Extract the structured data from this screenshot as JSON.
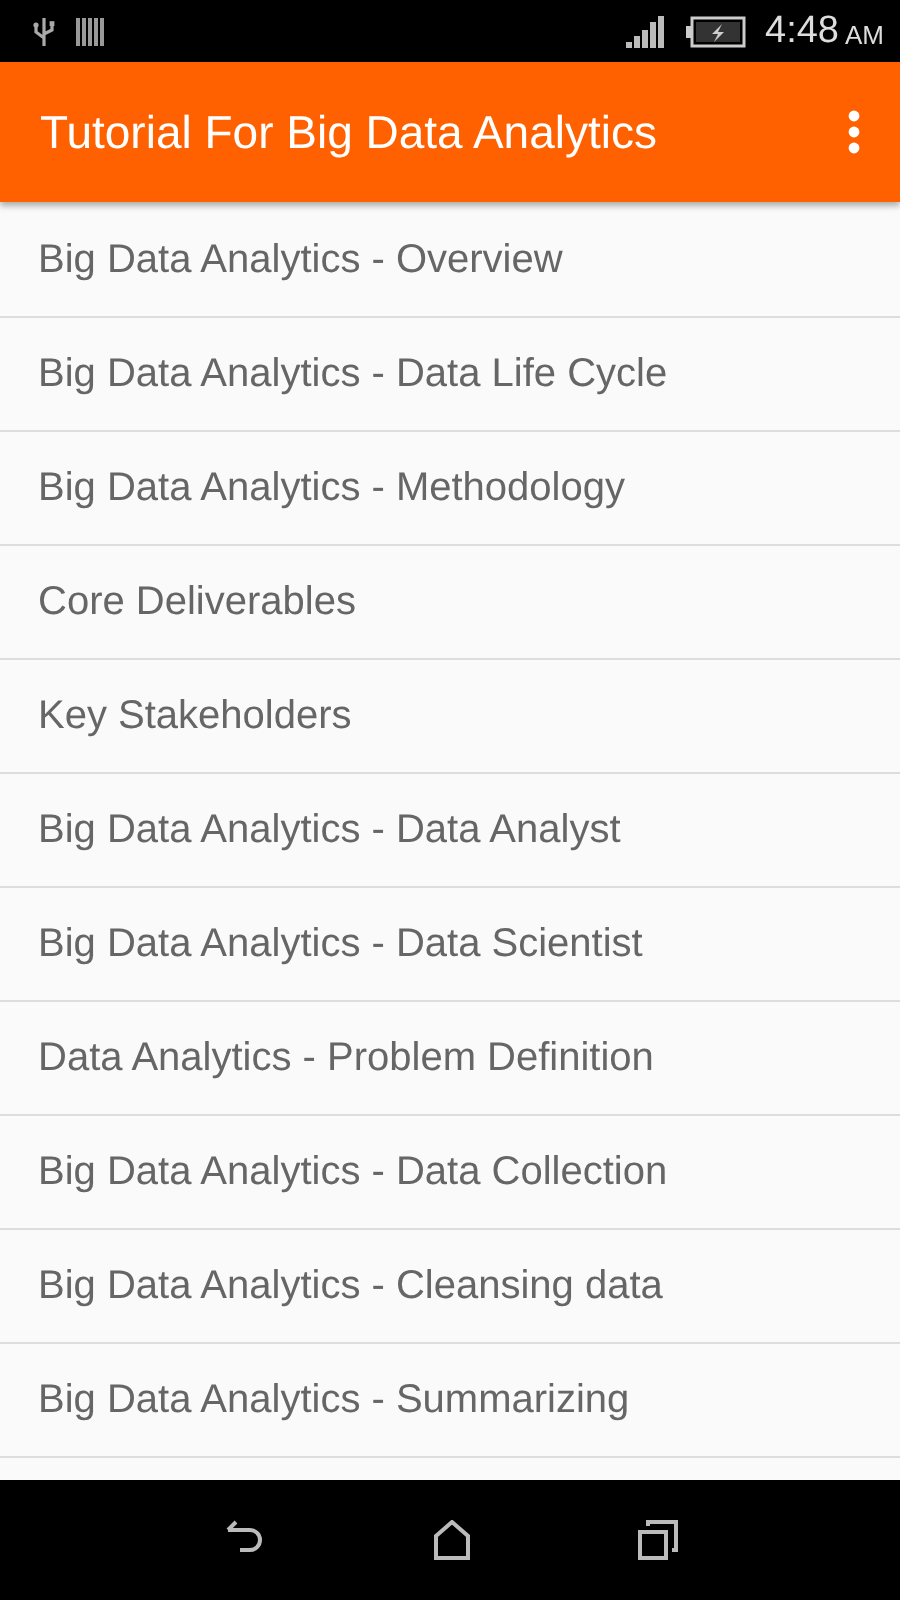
{
  "status_bar": {
    "time": "4:48",
    "meridiem": "AM"
  },
  "app_bar": {
    "title": "Tutorial For Big Data Analytics"
  },
  "topics": [
    {
      "title": "Big Data Analytics - Overview"
    },
    {
      "title": "Big Data Analytics - Data Life Cycle"
    },
    {
      "title": "Big Data Analytics - Methodology"
    },
    {
      "title": "Core Deliverables"
    },
    {
      "title": "Key Stakeholders"
    },
    {
      "title": "Big Data Analytics - Data Analyst"
    },
    {
      "title": "Big Data Analytics - Data Scientist"
    },
    {
      "title": "Data Analytics - Problem Definition"
    },
    {
      "title": "Big Data Analytics - Data Collection"
    },
    {
      "title": "Big Data Analytics - Cleansing data"
    },
    {
      "title": "Big Data Analytics - Summarizing"
    }
  ]
}
